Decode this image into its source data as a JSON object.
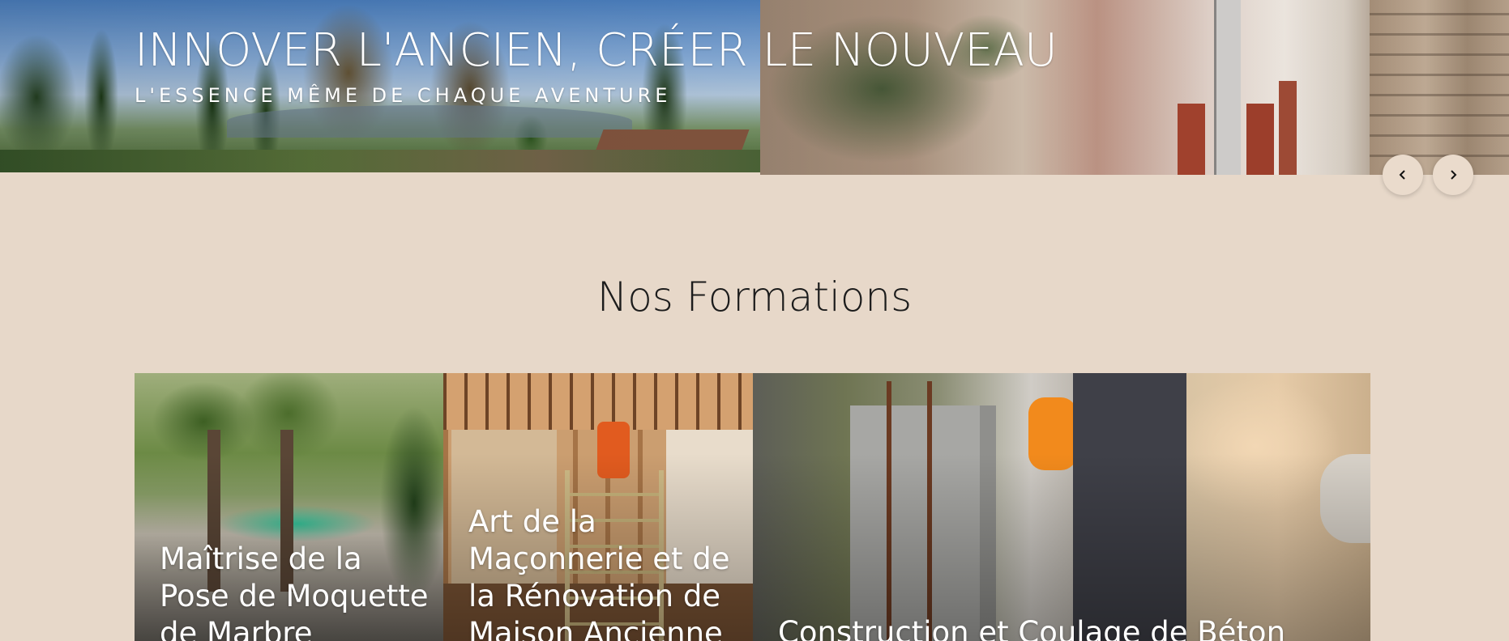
{
  "hero": {
    "title": "INNOVER L'ANCIEN, CRÉER LE NOUVEAU",
    "subtitle": "L'ESSENCE MÊME DE CHAQUE AVENTURE",
    "prev_icon": "chevron-left-icon",
    "next_icon": "chevron-right-icon"
  },
  "section": {
    "title": "Nos Formations"
  },
  "cards": [
    {
      "title": "Maîtrise de la Pose de Moquette de Marbre"
    },
    {
      "title": "Art de la Maçonnerie et de la Rénovation de Maison Ancienne"
    },
    {
      "title": "Construction et Coulage de Béton"
    }
  ],
  "colors": {
    "background": "#e7d8c9",
    "text": "#1c1c1c",
    "arrow_bg": "#eadbcc"
  }
}
